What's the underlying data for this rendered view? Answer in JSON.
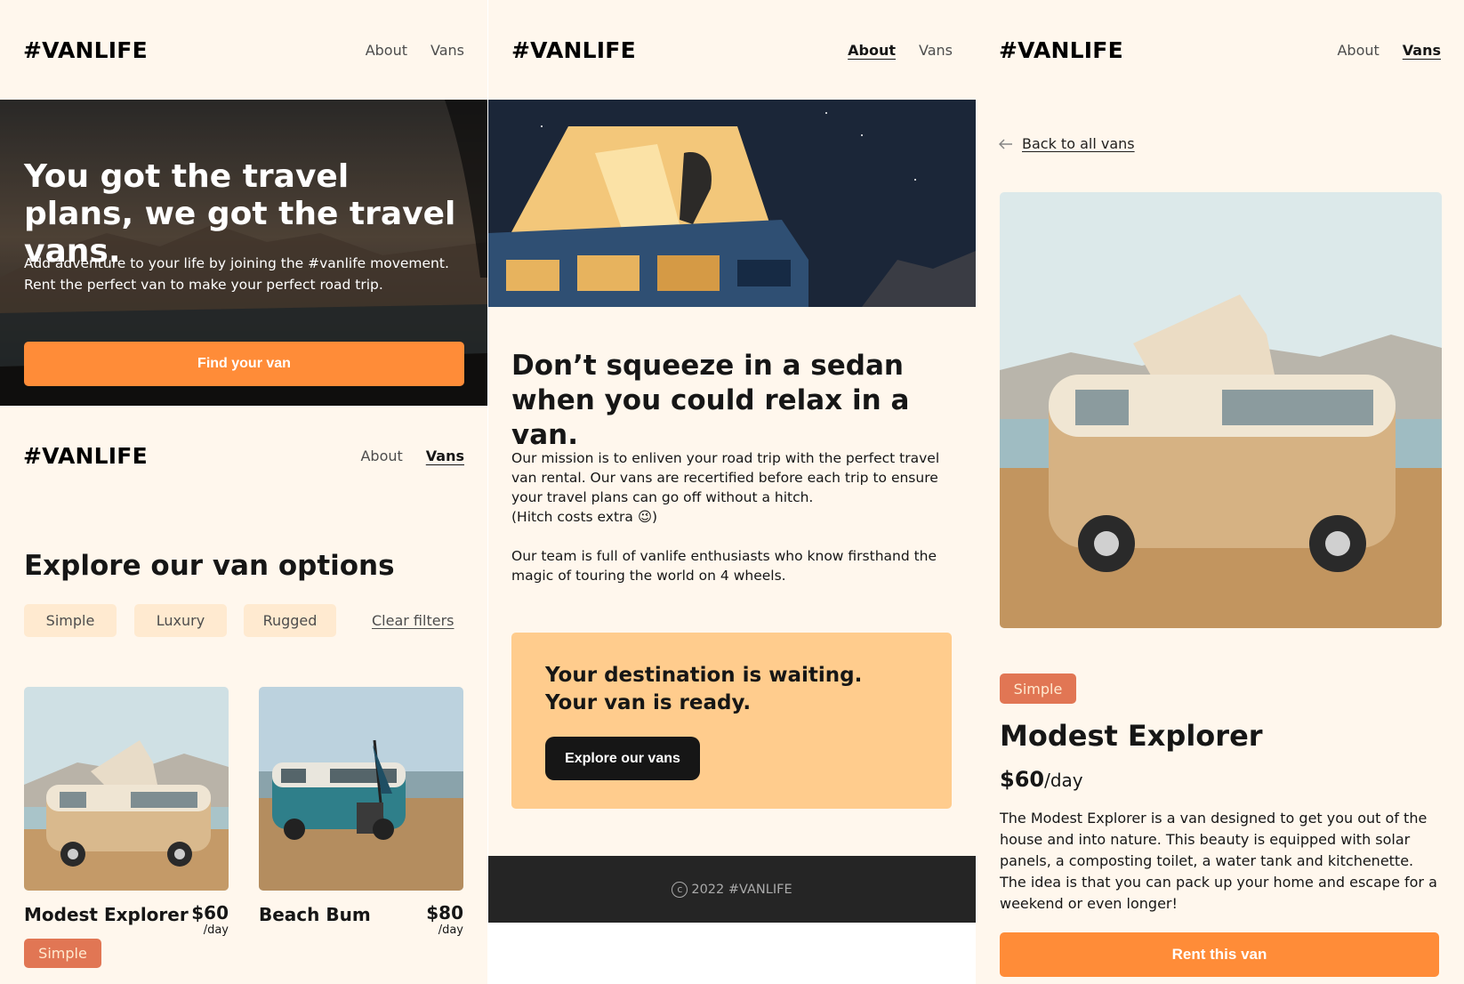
{
  "brand": {
    "logo": "#VANLIFE"
  },
  "nav": {
    "about": "About",
    "vans": "Vans"
  },
  "home": {
    "title": "You got the travel plans, we got the travel vans.",
    "subtitle": "Add adventure to your life by joining the #vanlife movement. Rent the perfect van to make your perfect road trip.",
    "cta": "Find your van"
  },
  "vans_list": {
    "title": "Explore our van options",
    "filters": [
      "Simple",
      "Luxury",
      "Rugged"
    ],
    "clear_filters": "Clear filters",
    "cards": [
      {
        "name": "Modest Explorer",
        "price": "$60",
        "per": "/day",
        "type": "Simple"
      },
      {
        "name": "Beach Bum",
        "price": "$80",
        "per": "/day"
      }
    ]
  },
  "about": {
    "title": "Don’t squeeze in a sedan when you could relax in a van.",
    "paragraph1": "Our mission is to enliven your road trip with the perfect travel van rental. Our vans are recertified before each trip to ensure your travel plans can go off without a hitch.",
    "paragraph1_note": "(Hitch costs extra 😉)",
    "paragraph2": "Our team is full of vanlife enthusiasts who know firsthand the magic of touring the world on 4 wheels.",
    "cta_title_line1": "Your destination is waiting.",
    "cta_title_line2": "Your van is ready.",
    "cta_button": "Explore our vans",
    "footer": "2022 #VANLIFE"
  },
  "detail": {
    "back": "Back to all vans",
    "type": "Simple",
    "name": "Modest Explorer",
    "price": "$60",
    "per": "/day",
    "description": "The Modest Explorer is a van designed to get you out of the house and into nature. This beauty is equipped with solar panels, a composting toilet, a water tank and kitchenette. The idea is that you can pack up your home and escape for a weekend or even longer!",
    "cta": "Rent this van"
  },
  "colors": {
    "background": "#FFF7ED",
    "orange": "#FF8C38",
    "badge_simple": "#E17654",
    "filter_bg": "#FFEAD0",
    "cta_box": "#FFCC8D",
    "dark": "#161616",
    "footer": "#252525"
  }
}
